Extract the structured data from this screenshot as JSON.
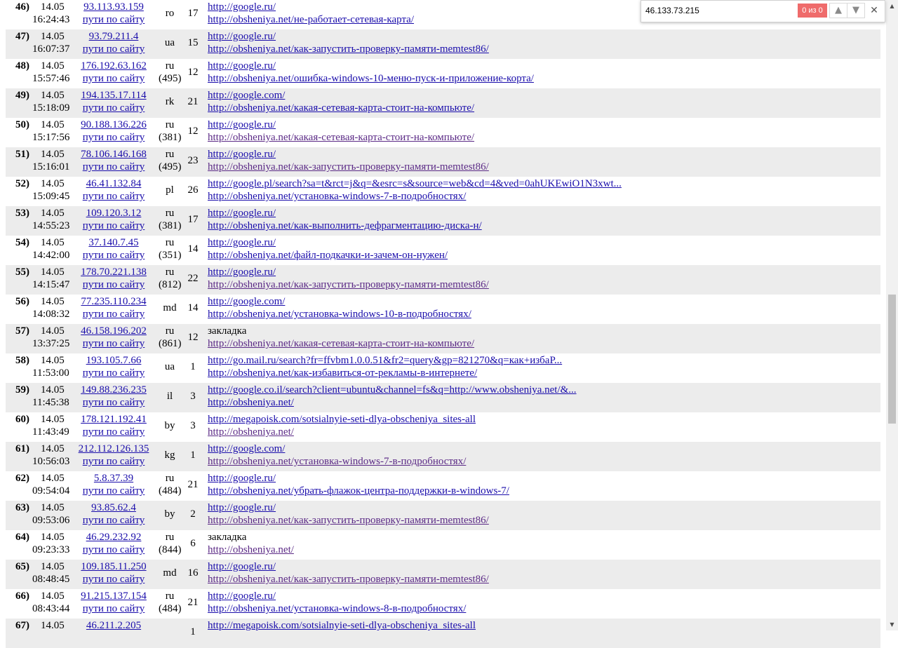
{
  "find_bar": {
    "query": "46.133.73.215",
    "match_count": "0 из 0",
    "prev_icon": "▲",
    "next_icon": "▼",
    "close_icon": "✕"
  },
  "scrollbar": {
    "up_icon": "▲",
    "down_icon": "▼"
  },
  "visits": [
    {
      "num": "46)",
      "date": "14.05",
      "time": "16:24:43",
      "ip": "93.113.93.159",
      "paths": "пути по сайту",
      "country": "ro",
      "region": "",
      "count": "17",
      "referrer": "http://google.ru/",
      "referrer_link": true,
      "page": "http://obsheniya.net/не-работает-сетевая-карта/"
    },
    {
      "num": "47)",
      "date": "14.05",
      "time": "16:07:37",
      "ip": "93.79.211.4",
      "paths": "пути по сайту",
      "country": "ua",
      "region": "",
      "count": "15",
      "referrer": "http://google.ru/",
      "referrer_link": true,
      "page": "http://obsheniya.net/как-запустить-проверку-памяти-memtest86/"
    },
    {
      "num": "48)",
      "date": "14.05",
      "time": "15:57:46",
      "ip": "176.192.63.162",
      "paths": "пути по сайту",
      "country": "ru",
      "region": "(495)",
      "count": "12",
      "referrer": "http://google.ru/",
      "referrer_link": true,
      "page": "http://obsheniya.net/ошибка-windows-10-меню-пуск-и-приложение-корта/"
    },
    {
      "num": "49)",
      "date": "14.05",
      "time": "15:18:09",
      "ip": "194.135.17.114",
      "paths": "пути по сайту",
      "country": "rk",
      "region": "",
      "count": "21",
      "referrer": "http://google.com/",
      "referrer_link": true,
      "page": "http://obsheniya.net/какая-сетевая-карта-стоит-на-компьюте/"
    },
    {
      "num": "50)",
      "date": "14.05",
      "time": "15:17:56",
      "ip": "90.188.136.226",
      "paths": "пути по сайту",
      "country": "ru",
      "region": "(381)",
      "count": "12",
      "referrer": "http://google.ru/",
      "referrer_link": true,
      "page": "http://obsheniya.net/какая-сетевая-карта-стоит-на-компьюте/"
    },
    {
      "num": "51)",
      "date": "14.05",
      "time": "15:16:01",
      "ip": "78.106.146.168",
      "paths": "пути по сайту",
      "country": "ru",
      "region": "(495)",
      "count": "23",
      "referrer": "http://google.ru/",
      "referrer_link": true,
      "page": "http://obsheniya.net/как-запустить-проверку-памяти-memtest86/"
    },
    {
      "num": "52)",
      "date": "14.05",
      "time": "15:09:45",
      "ip": "46.41.132.84",
      "paths": "пути по сайту",
      "country": "pl",
      "region": "",
      "count": "26",
      "referrer": "http://google.pl/search?sa=t&rct=j&q=&esrc=s&source=web&cd=4&ved=0ahUKEwiO1N3xwt...",
      "referrer_link": true,
      "page": "http://obsheniya.net/установка-windows-7-в-подробностях/"
    },
    {
      "num": "53)",
      "date": "14.05",
      "time": "14:55:23",
      "ip": "109.120.3.12",
      "paths": "пути по сайту",
      "country": "ru",
      "region": "(381)",
      "count": "17",
      "referrer": "http://google.ru/",
      "referrer_link": true,
      "page": "http://obsheniya.net/как-выполнить-дефрагментацию-диска-н/"
    },
    {
      "num": "54)",
      "date": "14.05",
      "time": "14:42:00",
      "ip": "37.140.7.45",
      "paths": "пути по сайту",
      "country": "ru",
      "region": "(351)",
      "count": "14",
      "referrer": "http://google.ru/",
      "referrer_link": true,
      "page": "http://obsheniya.net/файл-подкачки-и-зачем-он-нужен/"
    },
    {
      "num": "55)",
      "date": "14.05",
      "time": "14:15:47",
      "ip": "178.70.221.138",
      "paths": "пути по сайту",
      "country": "ru",
      "region": "(812)",
      "count": "22",
      "referrer": "http://google.ru/",
      "referrer_link": true,
      "page": "http://obsheniya.net/как-запустить-проверку-памяти-memtest86/"
    },
    {
      "num": "56)",
      "date": "14.05",
      "time": "14:08:32",
      "ip": "77.235.110.234",
      "paths": "пути по сайту",
      "country": "md",
      "region": "",
      "count": "14",
      "referrer": "http://google.com/",
      "referrer_link": true,
      "page": "http://obsheniya.net/установка-windows-10-в-подробностях/"
    },
    {
      "num": "57)",
      "date": "14.05",
      "time": "13:37:25",
      "ip": "46.158.196.202",
      "paths": "пути по сайту",
      "country": "ru",
      "region": "(861)",
      "count": "12",
      "referrer": "закладка",
      "referrer_link": false,
      "page": "http://obsheniya.net/какая-сетевая-карта-стоит-на-компьюте/"
    },
    {
      "num": "58)",
      "date": "14.05",
      "time": "11:53:00",
      "ip": "193.105.7.66",
      "paths": "пути по сайту",
      "country": "ua",
      "region": "",
      "count": "1",
      "referrer": "http://go.mail.ru/search?fr=ffvbm1.0.0.51&fr2=query&gp=821270&q=как+избаР...",
      "referrer_link": true,
      "page": "http://obsheniya.net/как-избавиться-от-рекламы-в-интернете/"
    },
    {
      "num": "59)",
      "date": "14.05",
      "time": "11:45:38",
      "ip": "149.88.236.235",
      "paths": "пути по сайту",
      "country": "il",
      "region": "",
      "count": "3",
      "referrer": "http://google.co.il/search?client=ubuntu&channel=fs&q=http://www.obsheniya.net/&...",
      "referrer_link": true,
      "page": "http://obsheniya.net/"
    },
    {
      "num": "60)",
      "date": "14.05",
      "time": "11:43:49",
      "ip": "178.121.192.41",
      "paths": "пути по сайту",
      "country": "by",
      "region": "",
      "count": "3",
      "referrer": "http://megapoisk.com/sotsialnyie-seti-dlya-obscheniya_sites-all",
      "referrer_link": true,
      "page": "http://obsheniya.net/"
    },
    {
      "num": "61)",
      "date": "14.05",
      "time": "10:56:03",
      "ip": "212.112.126.135",
      "paths": "пути по сайту",
      "country": "kg",
      "region": "",
      "count": "1",
      "referrer": "http://google.com/",
      "referrer_link": true,
      "page": "http://obsheniya.net/установка-windows-7-в-подробностях/"
    },
    {
      "num": "62)",
      "date": "14.05",
      "time": "09:54:04",
      "ip": "5.8.37.39",
      "paths": "пути по сайту",
      "country": "ru",
      "region": "(484)",
      "count": "21",
      "referrer": "http://google.ru/",
      "referrer_link": true,
      "page": "http://obsheniya.net/убрать-флажок-центра-поддержки-в-windows-7/"
    },
    {
      "num": "63)",
      "date": "14.05",
      "time": "09:53:06",
      "ip": "93.85.62.4",
      "paths": "пути по сайту",
      "country": "by",
      "region": "",
      "count": "2",
      "referrer": "http://google.ru/",
      "referrer_link": true,
      "page": "http://obsheniya.net/как-запустить-проверку-памяти-memtest86/"
    },
    {
      "num": "64)",
      "date": "14.05",
      "time": "09:23:33",
      "ip": "46.29.232.92",
      "paths": "пути по сайту",
      "country": "ru",
      "region": "(844)",
      "count": "6",
      "referrer": "закладка",
      "referrer_link": false,
      "page": "http://obsheniya.net/"
    },
    {
      "num": "65)",
      "date": "14.05",
      "time": "08:48:45",
      "ip": "109.185.11.250",
      "paths": "пути по сайту",
      "country": "md",
      "region": "",
      "count": "16",
      "referrer": "http://google.ru/",
      "referrer_link": true,
      "page": "http://obsheniya.net/как-запустить-проверку-памяти-memtest86/"
    },
    {
      "num": "66)",
      "date": "14.05",
      "time": "08:43:44",
      "ip": "91.215.137.154",
      "paths": "пути по сайту",
      "country": "ru",
      "region": "(484)",
      "count": "21",
      "referrer": "http://google.ru/",
      "referrer_link": true,
      "page": "http://obsheniya.net/установка-windows-8-в-подробностях/"
    },
    {
      "num": "67)",
      "date": "14.05",
      "time": "",
      "ip": "46.211.2.205",
      "paths": "",
      "country": "",
      "region": "",
      "count": "1",
      "referrer": "http://megapoisk.com/sotsialnyie-seti-dlya-obscheniya_sites-all",
      "referrer_link": true,
      "page": ""
    }
  ]
}
